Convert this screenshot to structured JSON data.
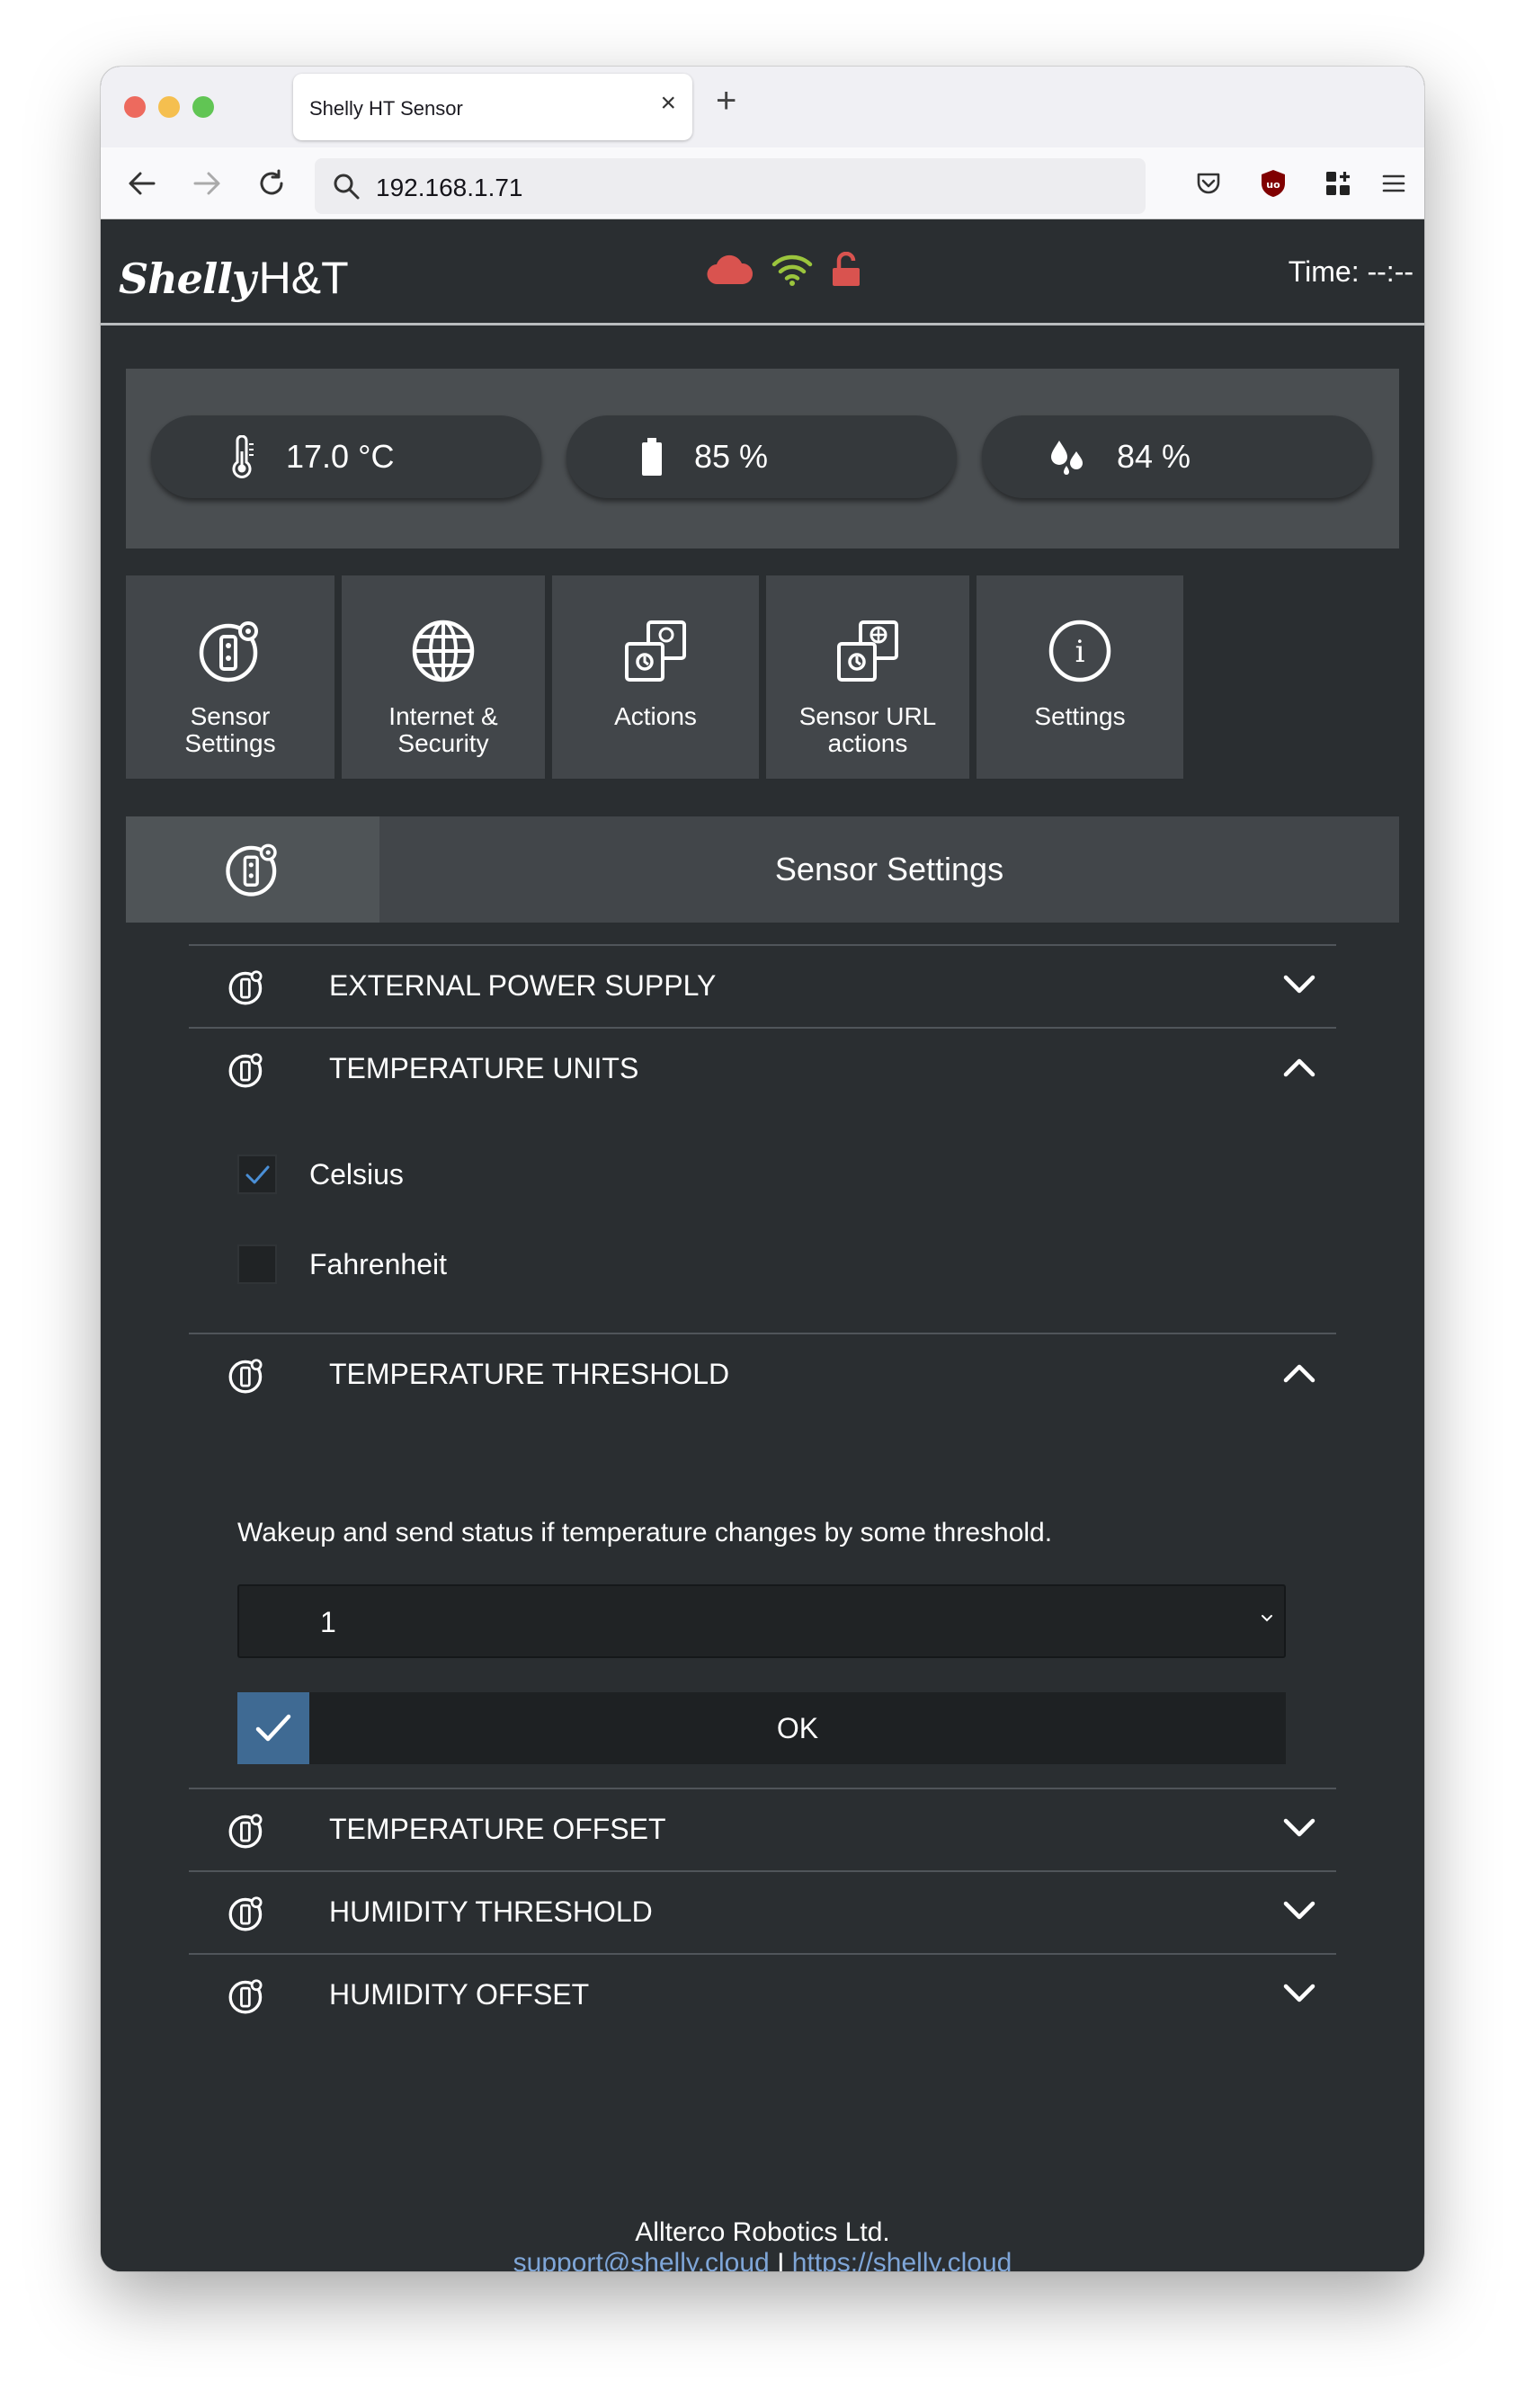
{
  "browser": {
    "tab_title": "Shelly HT Sensor",
    "url": "192.168.1.71"
  },
  "header": {
    "logo_script": "Shelly",
    "logo_model": "H&T",
    "time": "Time: --:--",
    "cloud_color": "#d9534f",
    "wifi_color": "#9bc53d",
    "lock_color": "#d9534f"
  },
  "sensors": {
    "temperature": "17.0 °C",
    "battery": "85 %",
    "humidity": "84 %"
  },
  "menu": [
    {
      "label": "Sensor\nSettings",
      "icon": "sensor-settings-icon"
    },
    {
      "label": "Internet &\nSecurity",
      "icon": "globe-icon"
    },
    {
      "label": "Actions",
      "icon": "actions-icon"
    },
    {
      "label": "Sensor URL\nactions",
      "icon": "url-actions-icon"
    },
    {
      "label": "Settings",
      "icon": "info-icon"
    }
  ],
  "section_title": "Sensor Settings",
  "accordion": {
    "external_power": "EXTERNAL POWER SUPPLY",
    "temp_units": "TEMPERATURE UNITS",
    "celsius": "Celsius",
    "fahrenheit": "Fahrenheit",
    "temp_threshold": "TEMPERATURE THRESHOLD",
    "threshold_desc": "Wakeup and send status if temperature changes by some threshold.",
    "threshold_value": "1",
    "ok_label": "OK",
    "temp_offset": "TEMPERATURE OFFSET",
    "humidity_threshold": "HUMIDITY THRESHOLD",
    "humidity_offset": "HUMIDITY OFFSET"
  },
  "footer": {
    "company": "Allterco Robotics Ltd.",
    "email": "support@shelly.cloud",
    "separator": "I",
    "website": "https://shelly.cloud"
  },
  "colors": {
    "accent_blue": "#3f6a93",
    "link_blue": "#7fa6d8",
    "background": "#2a2e31"
  }
}
